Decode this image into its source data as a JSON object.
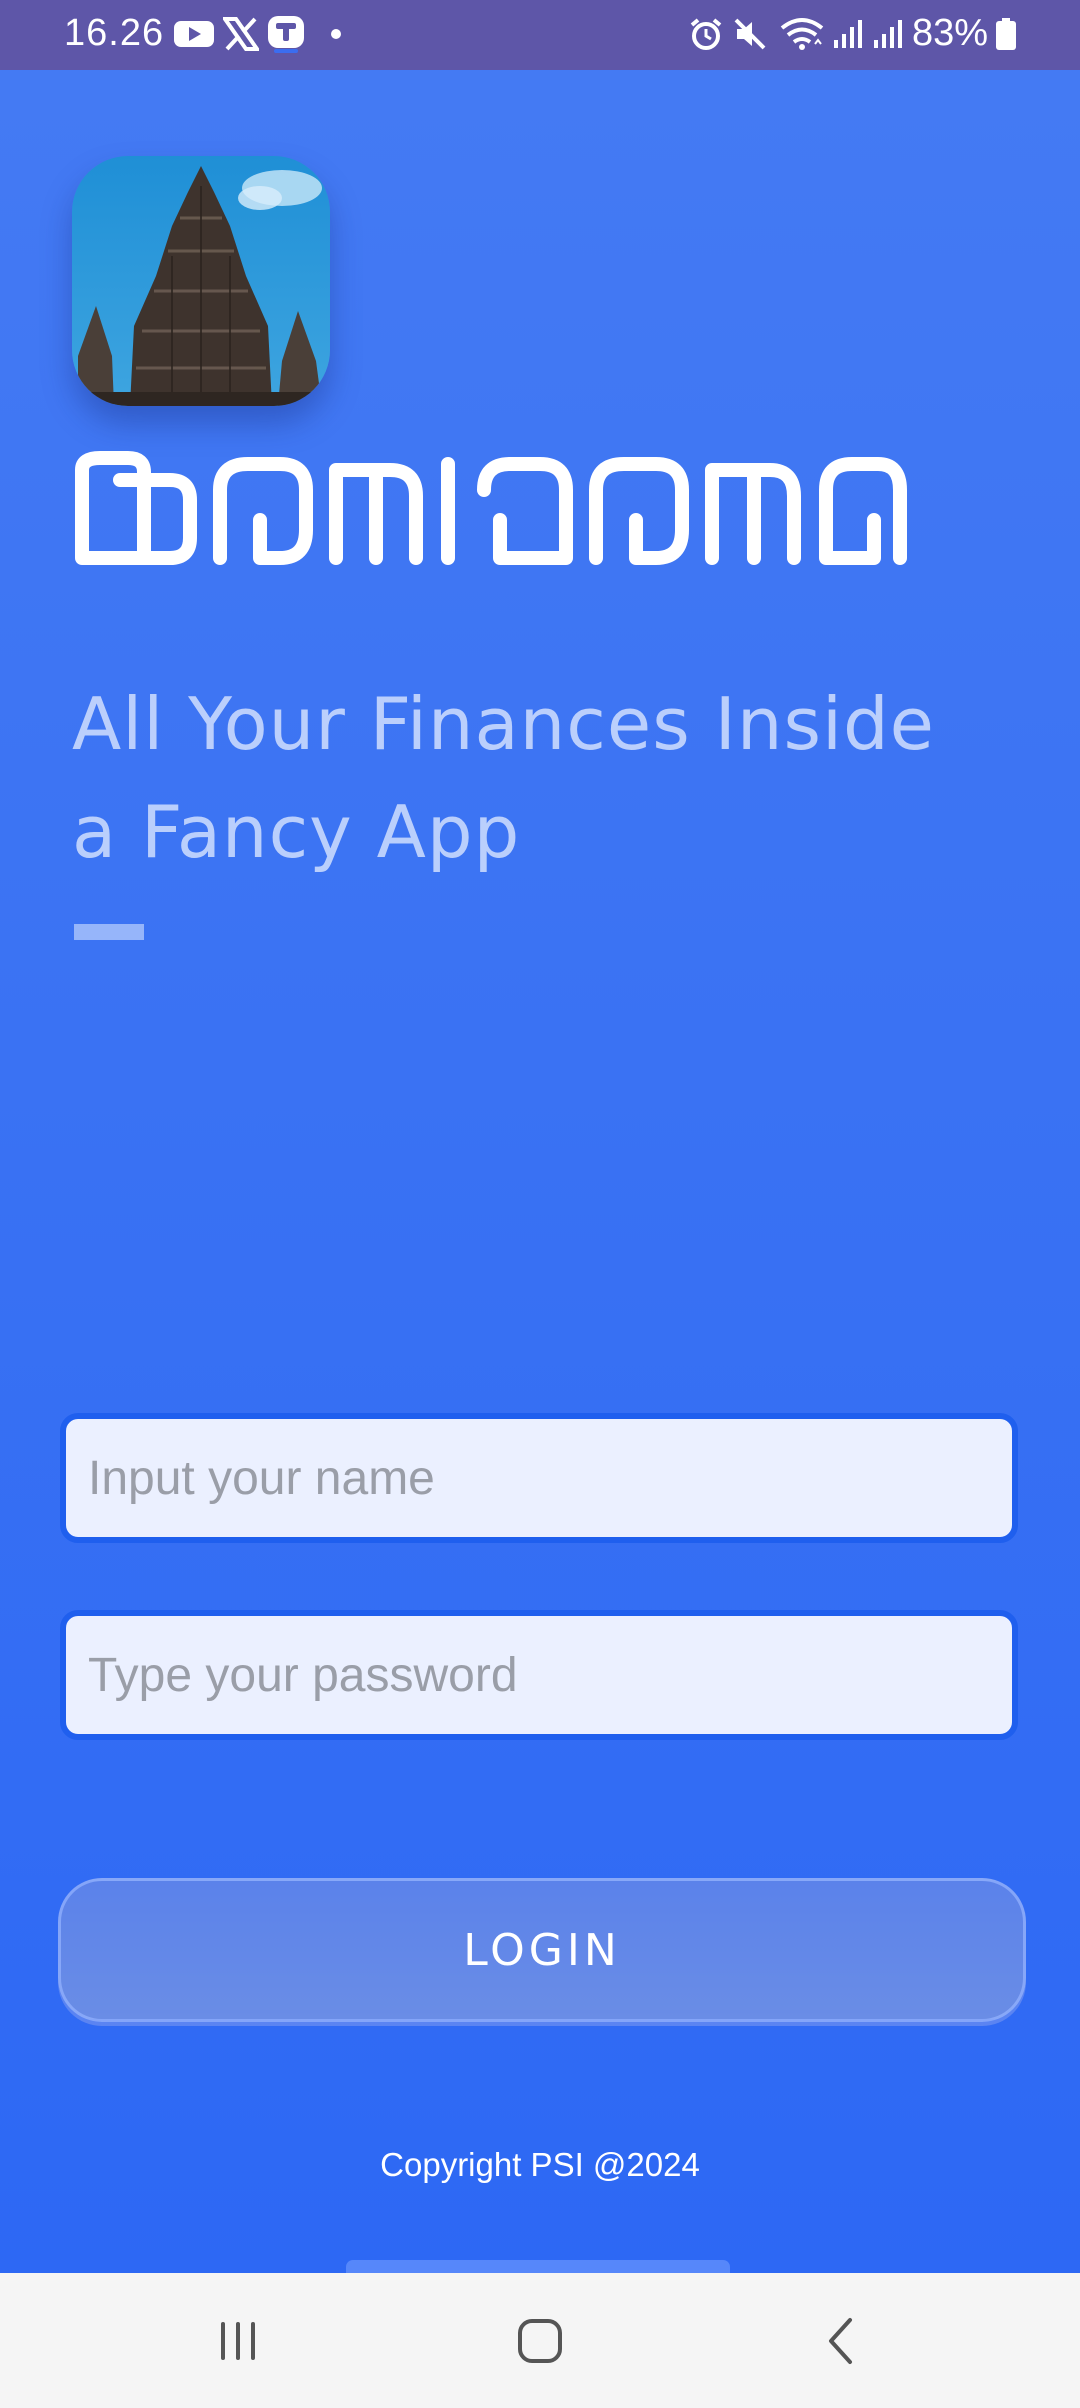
{
  "status_bar": {
    "time": "16.26",
    "battery": "83%",
    "left_icons": [
      "youtube-icon",
      "x-icon",
      "app-notification-icon",
      "dot-icon"
    ],
    "right_icons": [
      "alarm-icon",
      "mute-icon",
      "wifi-icon",
      "signal-icon",
      "signal-icon",
      "battery-icon"
    ]
  },
  "app": {
    "logo": "temple-logo",
    "brand_script": "ꦧꦺꦴꦤ꧀ꦠꦺꦴꦩꦤ꧀",
    "tagline_line1": "All Your Finances Inside",
    "tagline_line2": "a Fancy App",
    "name_placeholder": "Input your name",
    "password_placeholder": "Type your password",
    "login_label": "LOGIN",
    "copyright": "Copyright PSI @2024"
  },
  "nav_bar": {
    "buttons": [
      "recents-icon",
      "home-icon",
      "back-icon"
    ]
  },
  "colors": {
    "status_bar": "#5e56a8",
    "background": "#3a72f3",
    "field_background": "#ebf0ff",
    "field_border": "#1f5fee",
    "button": "#6a8de6"
  }
}
